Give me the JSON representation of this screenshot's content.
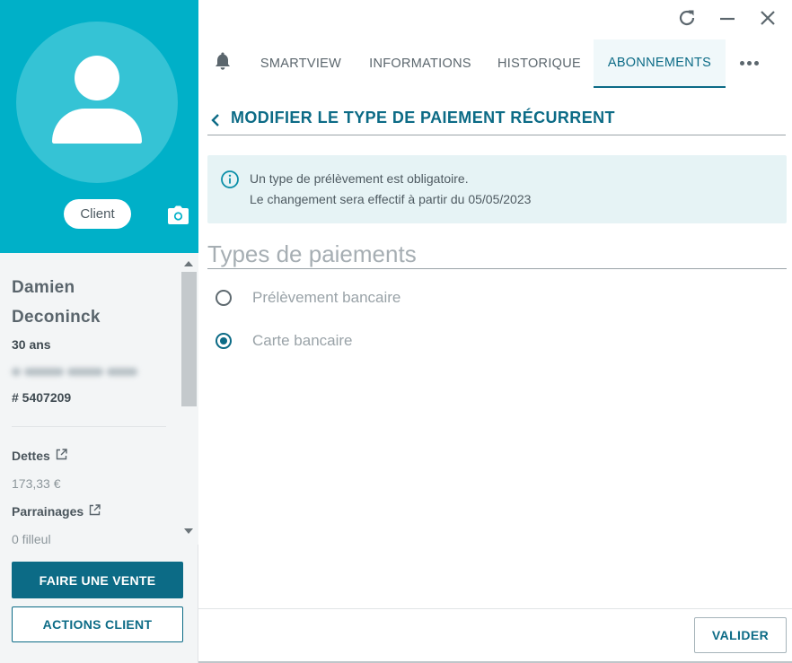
{
  "client": {
    "role_label": "Client",
    "first_name": "Damien",
    "last_name": "Deconinck",
    "age": "30 ans",
    "client_number": "# 5407209",
    "debts_label": "Dettes",
    "debts_value": "173,33 €",
    "sponsorships_label": "Parrainages",
    "sponsorships_value": "0 filleul"
  },
  "actions": {
    "sell_label": "FAIRE UNE VENTE",
    "client_actions_label": "ACTIONS CLIENT"
  },
  "tabs": [
    {
      "label": "SMARTVIEW",
      "active": false
    },
    {
      "label": "INFORMATIONS",
      "active": false
    },
    {
      "label": "HISTORIQUE",
      "active": false
    },
    {
      "label": "ABONNEMENTS",
      "active": true
    }
  ],
  "page": {
    "title": "MODIFIER LE TYPE DE PAIEMENT RÉCURRENT",
    "alert_line1": "Un type de prélèvement est obligatoire.",
    "alert_line2": "Le changement sera effectif à partir du 05/05/2023",
    "section_title": "Types de paiements",
    "options": [
      {
        "label": "Prélèvement bancaire",
        "selected": false
      },
      {
        "label": "Carte bancaire",
        "selected": true
      }
    ],
    "validate_label": "VALIDER"
  },
  "colors": {
    "hero": "#00b0c8",
    "accent": "#0c6b86",
    "alert_bg": "#e6f3f5"
  },
  "icons": {
    "refresh": "refresh-icon",
    "minimize": "minimize-icon",
    "close": "close-icon",
    "bell": "bell-icon",
    "more": "more-horizontal-icon",
    "back": "chevron-left-icon",
    "info": "info-circle-icon",
    "camera": "camera-icon",
    "external": "external-link-icon"
  }
}
